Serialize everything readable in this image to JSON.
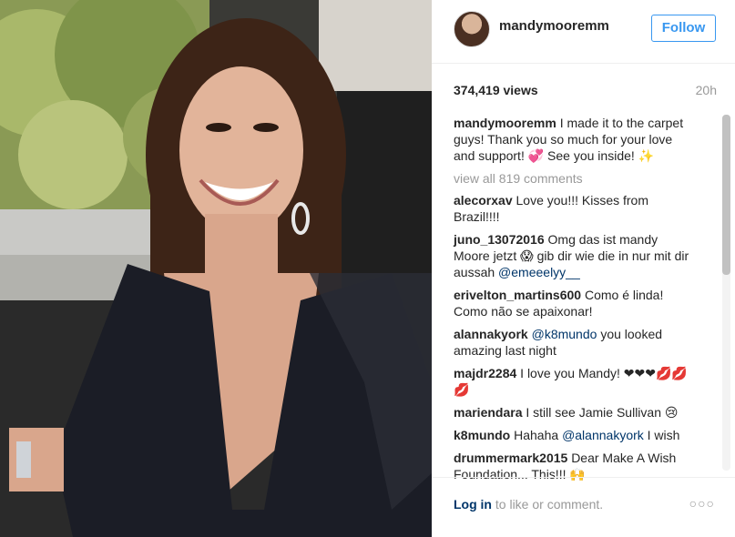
{
  "post": {
    "username": "mandymooremm",
    "follow_label": "Follow",
    "views": "374,419 views",
    "time_ago": "20h"
  },
  "caption": {
    "username": "mandymooremm",
    "text": "I made it to the carpet guys! Thank you so much for your love and support! 💞 See you inside! ✨"
  },
  "view_all_label": "view all 819 comments",
  "comments": [
    {
      "user": "alecorxav",
      "pre": "Love you!!! Kisses from Brazil!!!!",
      "mention": "",
      "post": ""
    },
    {
      "user": "juno_13072016",
      "pre": "Omg das ist mandy Moore jetzt 😱 gib dir wie die in nur mit dir aussah",
      "mention": "@emeeelyy__",
      "post": ""
    },
    {
      "user": "erivelton_martins600",
      "pre": "Como é linda! Como não se apaixonar!",
      "mention": "",
      "post": ""
    },
    {
      "user": "alannakyork",
      "pre": "",
      "mention": "@k8mundo",
      "post": "you looked amazing last night"
    },
    {
      "user": "majdr2284",
      "pre": "I love you Mandy! ❤❤❤💋💋💋",
      "mention": "",
      "post": ""
    },
    {
      "user": "mariendara",
      "pre": "I still see Jamie Sullivan 😢",
      "mention": "",
      "post": ""
    },
    {
      "user": "k8mundo",
      "pre": "Hahaha",
      "mention": "@alannakyork",
      "post": "I wish"
    },
    {
      "user": "drummermark2015",
      "pre": "Dear Make A Wish Foundation... This!!! 🙌",
      "mention": "",
      "post": ""
    }
  ],
  "footer": {
    "login_link": "Log in",
    "login_rest": " to like or comment.",
    "more_icon": "ellipsis-icon"
  },
  "colors": {
    "follow_blue": "#3897f0",
    "mention_blue": "#003569",
    "muted_gray": "#999999"
  }
}
